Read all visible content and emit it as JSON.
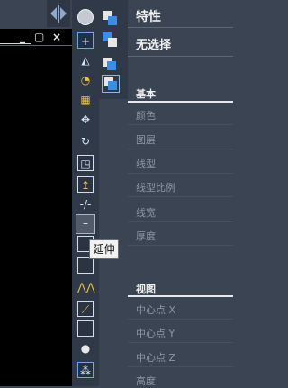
{
  "viewport": {
    "controls": [
      "_",
      "▢",
      "×"
    ]
  },
  "tooltip": {
    "text": "延伸"
  },
  "properties": {
    "title": "特性",
    "selection": "无选择",
    "sections": [
      {
        "title": "基本",
        "rows": [
          "颜色",
          "图层",
          "线型",
          "线型比例",
          "线宽",
          "厚度"
        ]
      },
      {
        "title": "视图",
        "rows": [
          "中心点 X",
          "中心点 Y",
          "中心点 Z",
          "高度"
        ]
      }
    ]
  },
  "toolbar": {
    "tools": [
      "erase-icon",
      "copy-icon",
      "mirror-icon",
      "offset-icon",
      "array-icon",
      "move-icon",
      "rotate-icon",
      "scale-icon",
      "stretch-icon",
      "trim-icon",
      "extend-icon",
      "break-at-point-icon",
      "break-icon",
      "join-icon",
      "chamfer-icon",
      "fillet-icon",
      "blend-curves-icon",
      "explode-icon"
    ],
    "draworder": [
      "bring-to-front-icon",
      "send-to-back-icon",
      "bring-above-icon",
      "send-under-icon"
    ]
  }
}
